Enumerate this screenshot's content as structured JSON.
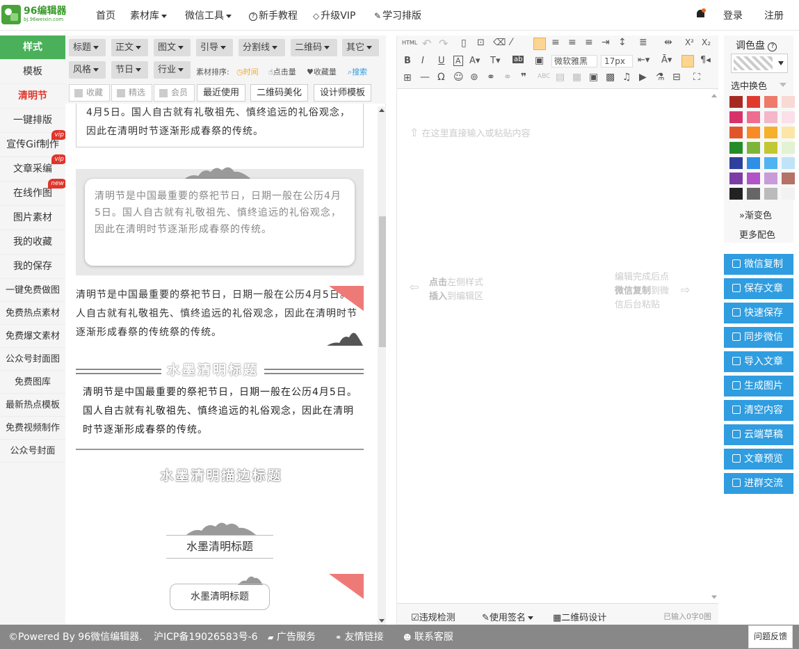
{
  "header": {
    "logo_text": "96编辑器",
    "logo_sub": "bj.96weixin.com",
    "nav": [
      "首页",
      "素材库",
      "微信工具",
      "新手教程",
      "升级VIP",
      "学习排版"
    ],
    "login": "登录",
    "register": "注册"
  },
  "sidebar": {
    "items": [
      "样式",
      "模板",
      "清明节",
      "一键排版",
      "宣传Gif制作",
      "文章采编",
      "在线作图",
      "图片素材",
      "我的收藏",
      "我的保存",
      "一键免费做图",
      "免费热点素材",
      "免费爆文素材",
      "公众号封面图",
      "免费图库",
      "最新热点模板",
      "免费视频制作",
      "公众号封面"
    ],
    "badges": {
      "gif": "vip",
      "article": "vip",
      "draw": "new"
    }
  },
  "materials": {
    "filters_row1": [
      "标题",
      "正文",
      "图文",
      "引导",
      "分割线",
      "二维码",
      "其它"
    ],
    "filters_row2": [
      "风格",
      "节日",
      "行业"
    ],
    "sort_label": "素材排序:",
    "sort_options": [
      "时间",
      "点击量",
      "收藏量",
      "搜索"
    ],
    "checks": [
      "收藏",
      "精选",
      "会员"
    ],
    "buttons": [
      "最近使用",
      "二维码美化",
      "设计师模板"
    ],
    "card1_text": "4月5日。国人自古就有礼敬祖先、慎终追远的礼俗观念，因此在清明时节逐渐形成春祭的传统。",
    "card2_text": "清明节是中国最重要的祭祀节日，日期一般在公历4月5日。国人自古就有礼敬祖先、慎终追远的礼俗观念，因此在清明时节逐渐形成春祭的传统。",
    "card3_text": "清明节是中国最重要的祭祀节日，日期一般在公历4月5日。国人自古就有礼敬祖先、慎终追远的礼俗观念，因此在清明时节逐渐形成春祭的传统祭的传统。",
    "ink_title": "水墨清明标题",
    "card4_text": "清明节是中国最重要的祭祀节日，日期一般在公历4月5日。国人自古就有礼敬祖先、慎终追远的礼俗观念，因此在清明时节逐渐形成春祭的传统。",
    "outline_title": "水墨清明描边标题",
    "title3": "水墨清明标题",
    "title4": "水墨清明标题"
  },
  "editor": {
    "font": "微软雅黑",
    "size": "17px",
    "placeholder": "在这里直接输入或粘贴内容",
    "hint_left_bold1": "点击",
    "hint_left_1": "左侧样式",
    "hint_left_bold2": "插入",
    "hint_left_2": "到编辑区",
    "hint_right_1": "编辑完成后点",
    "hint_right_bold": "微信复制",
    "hint_right_2": "到微",
    "hint_right_3": "信后台粘贴",
    "footer": {
      "check": "违规检测",
      "sign": "使用签名",
      "qr": "二维码设计",
      "count": "已输入0字0图"
    }
  },
  "palette": {
    "title": "调色盘",
    "select_label": "选中换色",
    "gradient": "渐变色",
    "more": "更多配色",
    "colors": [
      "#a62a22",
      "#e03a2e",
      "#ee7a6a",
      "#f9d9d4",
      "#d7336a",
      "#ee6d91",
      "#f4b6c9",
      "#fbe0e9",
      "#e0552a",
      "#f98b25",
      "#f7b02a",
      "#fbe6a8",
      "#268b2a",
      "#7fb43a",
      "#c1c832",
      "#e3f2d2",
      "#2f3f9e",
      "#2f8ee5",
      "#4fb4ef",
      "#bfe4f7",
      "#7c3ca6",
      "#b054c8",
      "#c89cd8",
      "#b57266",
      "#222222",
      "#666666",
      "#bbbbbb",
      "#f2f2f2"
    ]
  },
  "actions": [
    "微信复制",
    "保存文章",
    "快速保存",
    "同步微信",
    "导入文章",
    "生成图片",
    "清空内容",
    "云端草稿",
    "文章预览",
    "进群交流"
  ],
  "footer": {
    "powered": "©Powered By 96微信编辑器.",
    "icp": "沪ICP备19026583号-6",
    "ad": "广告服务",
    "links": "友情链接",
    "service": "联系客服",
    "feedback": "问题反馈"
  }
}
